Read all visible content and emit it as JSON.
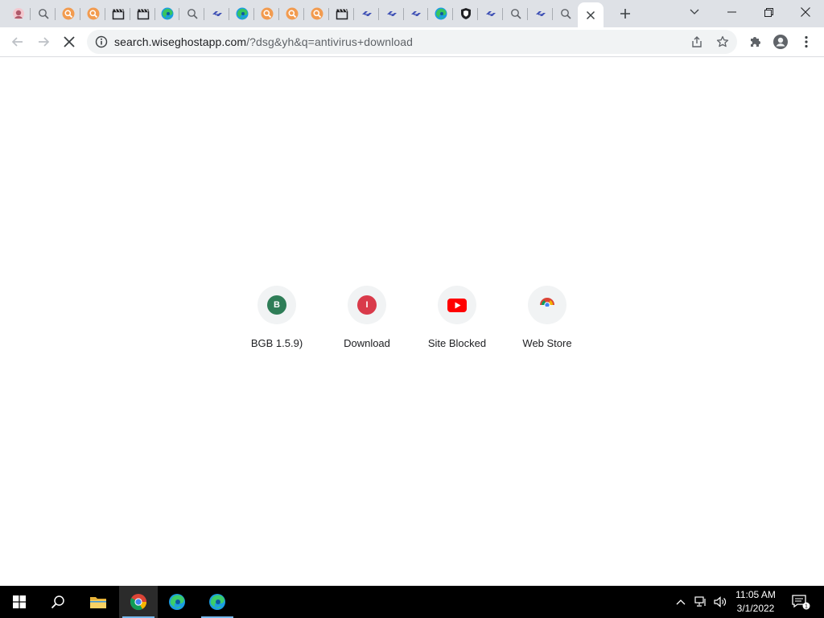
{
  "browser": {
    "tabs": [
      {
        "icon": "page-favicon-pink"
      },
      {
        "icon": "search-icon"
      },
      {
        "icon": "orange-search-icon"
      },
      {
        "icon": "orange-search-icon"
      },
      {
        "icon": "clapperboard-icon"
      },
      {
        "icon": "clapperboard-icon"
      },
      {
        "icon": "green-swirl-icon"
      },
      {
        "icon": "search-icon"
      },
      {
        "icon": "blue-link-icon"
      },
      {
        "icon": "green-swirl-icon"
      },
      {
        "icon": "orange-search-icon"
      },
      {
        "icon": "orange-search-icon"
      },
      {
        "icon": "orange-search-icon"
      },
      {
        "icon": "clapperboard-icon"
      },
      {
        "icon": "blue-link-icon"
      },
      {
        "icon": "blue-link-icon"
      },
      {
        "icon": "blue-link-icon"
      },
      {
        "icon": "green-swirl-icon"
      },
      {
        "icon": "shield-icon"
      },
      {
        "icon": "blue-link-icon"
      },
      {
        "icon": "search-icon"
      },
      {
        "icon": "blue-link-icon"
      },
      {
        "icon": "search-icon"
      },
      {
        "icon": "close-icon",
        "active": true
      }
    ],
    "url_host": "search.wiseghostapp.com",
    "url_rest": "/?dsg&yh&q=antivirus+download"
  },
  "shortcuts": [
    {
      "label": "BGB 1.5.9)",
      "letter": "B",
      "color": "#2e7d57"
    },
    {
      "label": "Download",
      "letter": "I",
      "color": "#d93a4a"
    },
    {
      "label": "Site Blocked",
      "icon": "youtube-icon",
      "color": "#ff0000"
    },
    {
      "label": "Web Store",
      "icon": "chrome-web-store-icon"
    }
  ],
  "taskbar": {
    "apps": [
      "windows-start-icon",
      "search-icon",
      "file-explorer-icon",
      "chrome-icon",
      "edge-icon",
      "edge-icon"
    ],
    "time": "11:05 AM",
    "date": "3/1/2022",
    "notification_count": "1"
  }
}
